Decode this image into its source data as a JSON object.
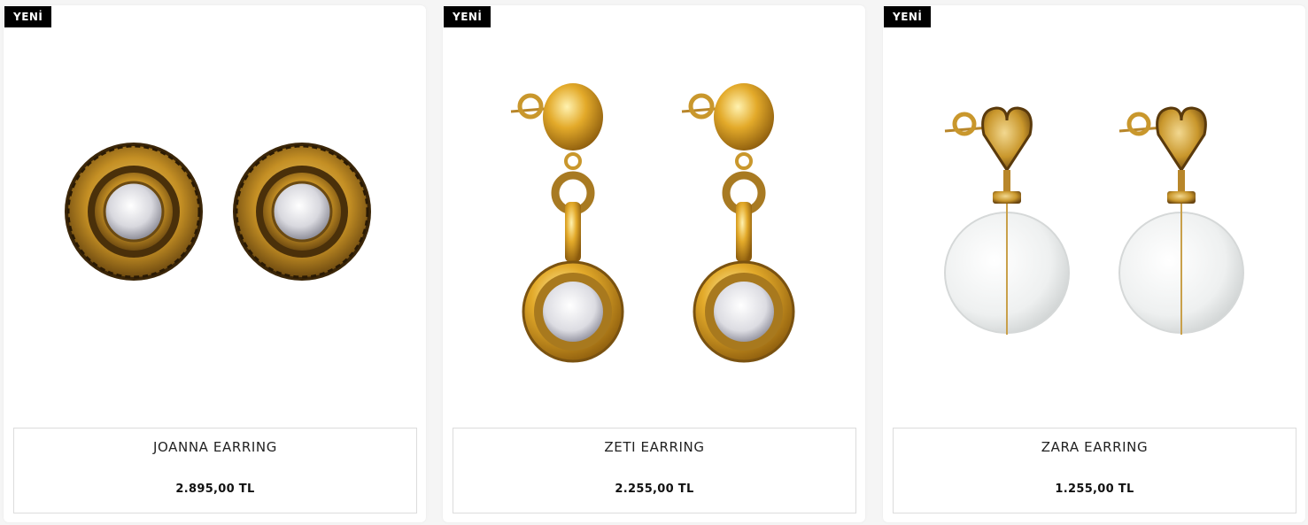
{
  "products": [
    {
      "badge": "YENİ",
      "name": "JOANNA EARRING",
      "price": "2.895,00 TL",
      "image_icon": "stud-earrings-image"
    },
    {
      "badge": "YENİ",
      "name": "ZETI EARRING",
      "price": "2.255,00 TL",
      "image_icon": "drop-earrings-image"
    },
    {
      "badge": "YENİ",
      "name": "ZARA EARRING",
      "price": "1.255,00 TL",
      "image_icon": "crystal-heart-earrings-image"
    }
  ],
  "colors": {
    "badge_bg": "#000000",
    "badge_text": "#ffffff",
    "gold": "#c9972c",
    "card_bg": "#ffffff",
    "page_bg": "#f5f5f5"
  }
}
